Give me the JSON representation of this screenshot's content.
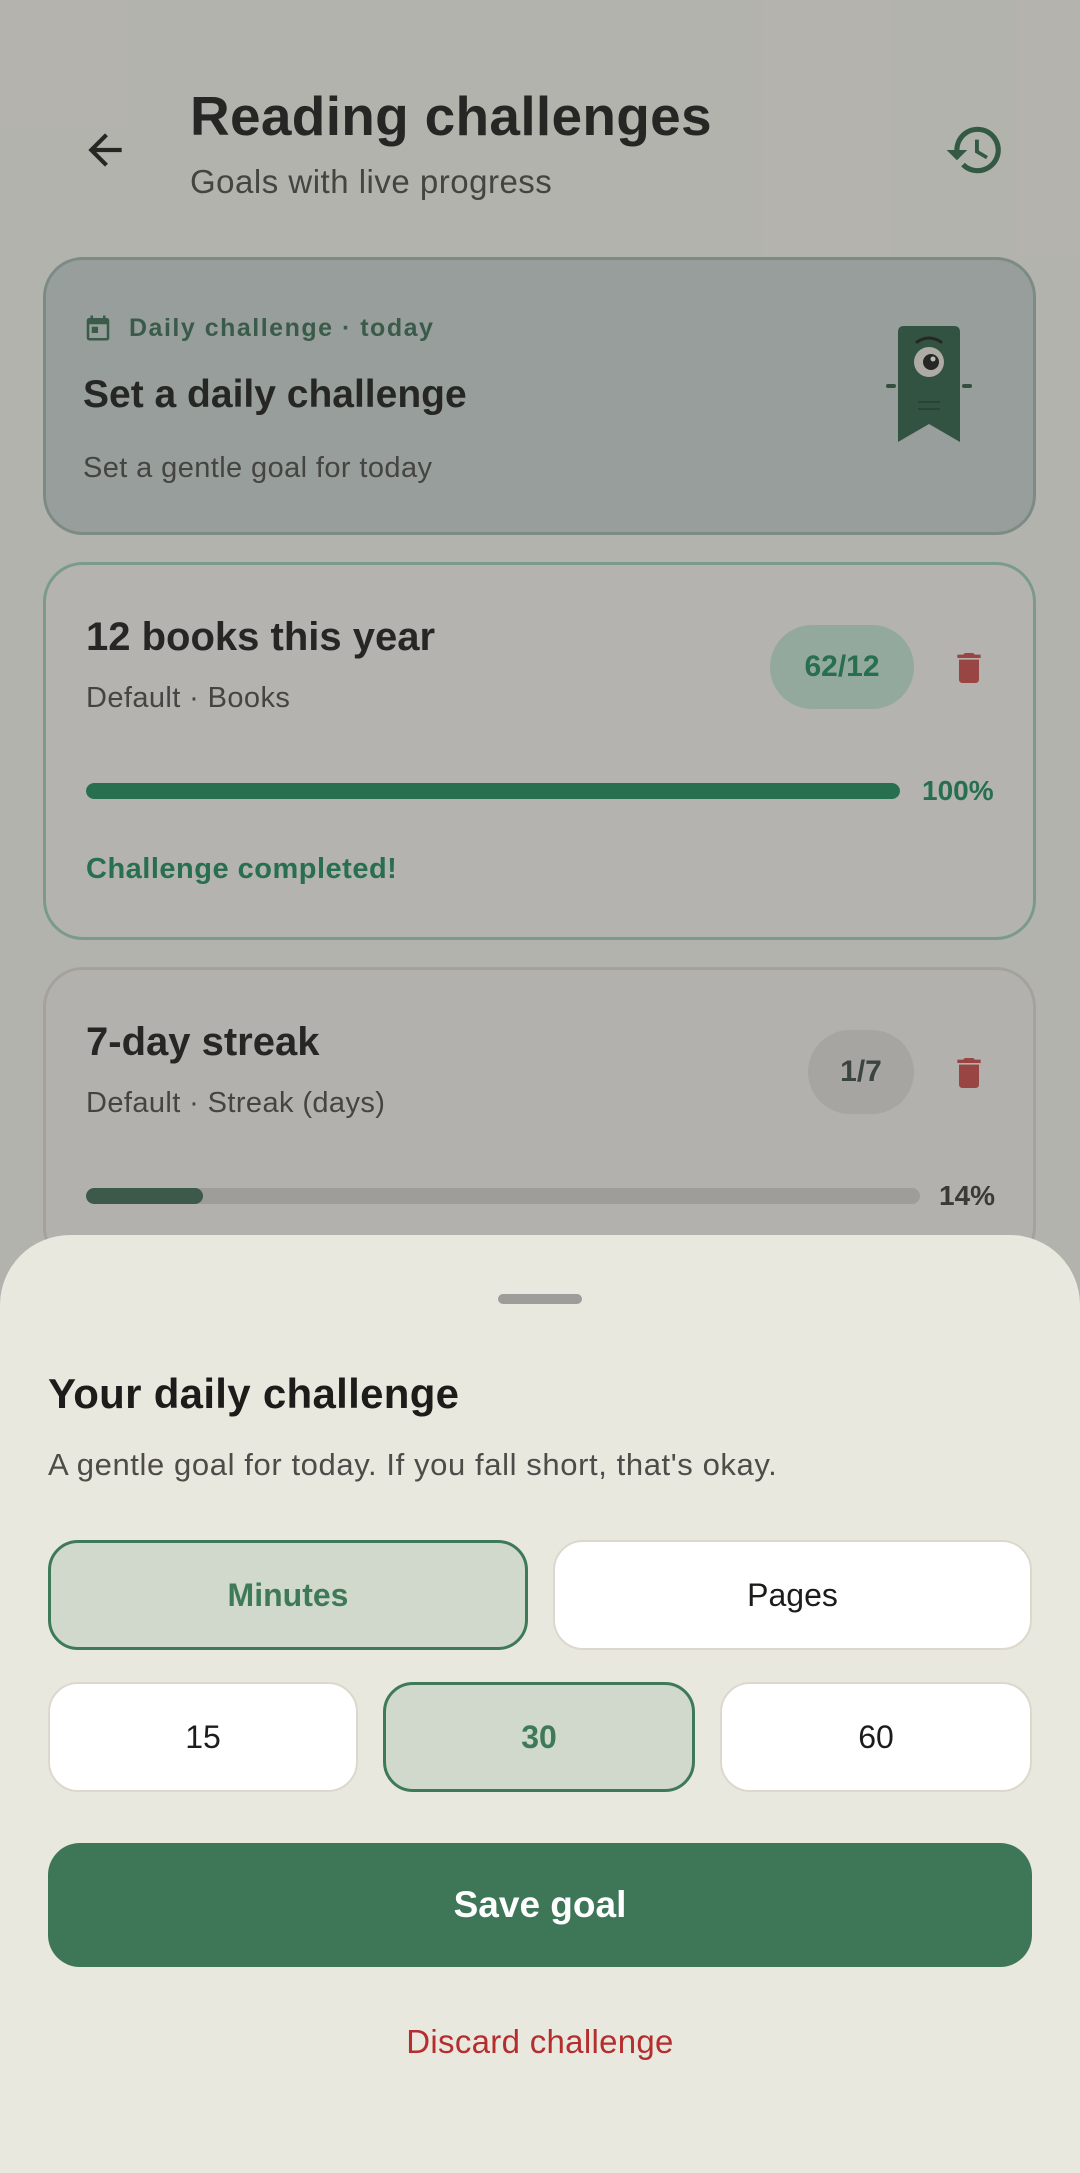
{
  "header": {
    "title": "Reading challenges",
    "subtitle": "Goals with live progress"
  },
  "daily_card": {
    "label": "Daily challenge · today",
    "title": "Set a daily challenge",
    "subtitle": "Set a gentle goal for today"
  },
  "challenges": [
    {
      "title": "12 books this year",
      "subtitle": "Default · Books",
      "count": "62/12",
      "percent_label": "100%",
      "progress": 1.0,
      "status": "Challenge completed!"
    },
    {
      "title": "7-day streak",
      "subtitle": "Default · Streak (days)",
      "count": "1/7",
      "percent_label": "14%",
      "progress": 0.14
    }
  ],
  "sheet": {
    "title": "Your daily challenge",
    "subtitle": "A gentle goal for today. If you fall short, that's okay.",
    "units": [
      "Minutes",
      "Pages"
    ],
    "selected_unit": "Minutes",
    "amounts": [
      "15",
      "30",
      "60"
    ],
    "selected_amount": "30",
    "save_label": "Save goal",
    "discard_label": "Discard challenge"
  },
  "colors": {
    "accent": "#3e7658",
    "complete": "#1f8a5c",
    "danger": "#b52e2e"
  },
  "icons": {
    "back": "arrow-left-icon",
    "history": "history-icon",
    "calendar": "calendar-icon",
    "delete": "trash-icon",
    "mascot": "bookmark-mascot-icon"
  }
}
